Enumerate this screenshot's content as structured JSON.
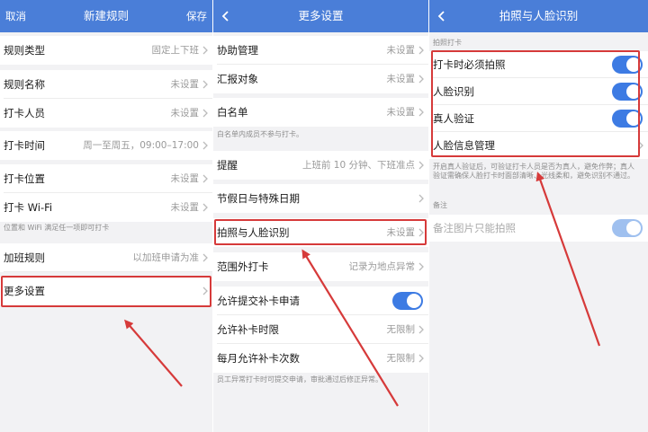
{
  "panel1": {
    "cancel": "取消",
    "title": "新建规则",
    "save": "保存",
    "rows": [
      {
        "label": "规则类型",
        "value": "固定上下班"
      },
      {
        "label": "规则名称",
        "value": "未设置"
      },
      {
        "label": "打卡人员",
        "value": "未设置"
      },
      {
        "label": "打卡时间",
        "value": "周一至周五，09:00–17:00"
      },
      {
        "label": "打卡位置",
        "value": "未设置"
      },
      {
        "label": "打卡 Wi-Fi",
        "value": "未设置"
      },
      {
        "label": "加班规则",
        "value": "以加班申请为准"
      },
      {
        "label": "更多设置",
        "value": ""
      }
    ],
    "note_location": "位置和 WiFi 满足任一项即可打卡"
  },
  "panel2": {
    "title": "更多设置",
    "rows": [
      {
        "label": "协助管理",
        "value": "未设置"
      },
      {
        "label": "汇报对象",
        "value": "未设置"
      },
      {
        "label": "白名单",
        "value": "未设置"
      },
      {
        "label": "提醒",
        "value": "上班前 10 分钟、下班准点"
      },
      {
        "label": "节假日与特殊日期",
        "value": ""
      },
      {
        "label": "拍照与人脸识别",
        "value": "未设置"
      },
      {
        "label": "范围外打卡",
        "value": "记录为地点异常"
      },
      {
        "label": "允许提交补卡申请",
        "value": ""
      },
      {
        "label": "允许补卡时限",
        "value": "无限制"
      },
      {
        "label": "每月允许补卡次数",
        "value": "无限制"
      }
    ],
    "note_whitelist": "白名单内成员不参与打卡。",
    "note_makeup": "员工异常打卡时可提交申请，审批通过后修正异常。"
  },
  "panel3": {
    "title": "拍照与人脸识别",
    "section_checkin": "拍照打卡",
    "rows": [
      {
        "label": "打卡时必须拍照"
      },
      {
        "label": "人脸识别"
      },
      {
        "label": "真人验证"
      },
      {
        "label": "人脸信息管理"
      }
    ],
    "note_verify": "开启真人验证后，可验证打卡人员是否为真人，避免作弊；真人验证需确保人脸打卡时面部清晰、光线柔和，避免识别不通过。",
    "section_remark": "备注",
    "remark_row": "备注图片只能拍照"
  },
  "colors": {
    "header": "#4a7ed8",
    "toggle_on": "#3d7be3",
    "highlight": "#d63a3a"
  },
  "toggles": {
    "allow_makeup": true,
    "must_photo": true,
    "face_recognition": true,
    "liveness": true,
    "remark_photo_only": true
  }
}
